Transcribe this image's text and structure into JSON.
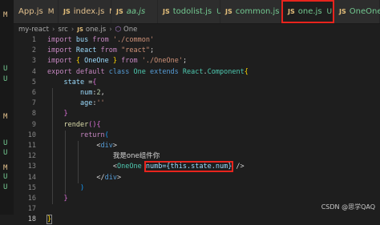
{
  "tabs": [
    {
      "label": "App.js",
      "badge": "M",
      "kind": "m"
    },
    {
      "label": "index.js",
      "badge": "M",
      "kind": "m",
      "icon": "JS"
    },
    {
      "label": "aa.js",
      "badge": "",
      "kind": "u",
      "icon": "JS"
    },
    {
      "label": "todolist.js",
      "badge": "U",
      "kind": "u",
      "icon": "JS"
    },
    {
      "label": "common.js",
      "badge": "U",
      "kind": "u",
      "icon": "JS"
    },
    {
      "label": "one.js",
      "badge": "U",
      "kind": "u",
      "icon": "JS",
      "active": true
    },
    {
      "label": "OneOne",
      "badge": "",
      "kind": "u",
      "icon": "JS"
    }
  ],
  "breadcrumb": {
    "items": [
      "my-react",
      "src",
      "one.js",
      "One"
    ],
    "icon": "JS"
  },
  "activity_letters": [
    {
      "text": "M",
      "kind": "m"
    },
    {
      "text": "U",
      "kind": "u"
    },
    {
      "text": "U",
      "kind": "u"
    },
    {
      "text": "M",
      "kind": "m"
    },
    {
      "text": "U",
      "kind": "u"
    },
    {
      "text": "U",
      "kind": "u"
    },
    {
      "text": "M",
      "kind": "m"
    },
    {
      "text": "U",
      "kind": "u"
    },
    {
      "text": "U",
      "kind": "u"
    }
  ],
  "code_lines": [
    {
      "n": "1",
      "segs": [
        [
          "kw",
          "import "
        ],
        [
          "var",
          "bus"
        ],
        [
          "kw",
          " from "
        ],
        [
          "str",
          "'./common'"
        ]
      ]
    },
    {
      "n": "2",
      "segs": [
        [
          "kw",
          "import "
        ],
        [
          "var",
          "React"
        ],
        [
          "kw",
          " from "
        ],
        [
          "str",
          "\"react\""
        ],
        [
          "",
          "; "
        ]
      ]
    },
    {
      "n": "3",
      "segs": [
        [
          "kw",
          "import "
        ],
        [
          "br1",
          "{ "
        ],
        [
          "var",
          "OneOne"
        ],
        [
          "br1",
          " }"
        ],
        [
          "kw",
          " from "
        ],
        [
          "str",
          "'./OneOne'"
        ],
        [
          "",
          ";"
        ]
      ]
    },
    {
      "n": "4",
      "segs": [
        [
          "kw",
          "export default "
        ],
        [
          "kb",
          "class "
        ],
        [
          "cls",
          "One "
        ],
        [
          "kb",
          "extends "
        ],
        [
          "cls",
          "React"
        ],
        [
          "",
          "."
        ],
        [
          "cls",
          "Component"
        ],
        [
          "br1",
          "{"
        ]
      ]
    },
    {
      "n": "5",
      "segs": [
        [
          "",
          "    "
        ],
        [
          "var",
          "state"
        ],
        [
          "",
          " ="
        ],
        [
          "br2",
          "{"
        ]
      ]
    },
    {
      "n": "6",
      "segs": [
        [
          "",
          "        "
        ],
        [
          "var",
          "num"
        ],
        [
          "",
          ":"
        ],
        [
          "num",
          "2"
        ],
        [
          "",
          ","
        ]
      ]
    },
    {
      "n": "7",
      "segs": [
        [
          "",
          "        "
        ],
        [
          "var",
          "age"
        ],
        [
          "",
          ":"
        ],
        [
          "str",
          "''"
        ]
      ]
    },
    {
      "n": "8",
      "segs": [
        [
          "",
          "    "
        ],
        [
          "br2",
          "}"
        ]
      ]
    },
    {
      "n": "9",
      "segs": [
        [
          "",
          "    "
        ],
        [
          "fn",
          "render"
        ],
        [
          "br2",
          "()"
        ],
        [
          "br2",
          "{"
        ]
      ]
    },
    {
      "n": "10",
      "segs": [
        [
          "",
          "        "
        ],
        [
          "kw",
          "return"
        ],
        [
          "br3",
          "("
        ]
      ]
    },
    {
      "n": "11",
      "segs": [
        [
          "",
          "            "
        ],
        [
          "",
          "<"
        ],
        [
          "tag",
          "div"
        ],
        [
          "",
          ">"
        ]
      ]
    },
    {
      "n": "12",
      "segs": [
        [
          "",
          "                "
        ],
        [
          "jsxt",
          "我是one组件你"
        ]
      ]
    },
    {
      "n": "13",
      "segs": [
        [
          "",
          "                "
        ],
        [
          "",
          "<"
        ],
        [
          "cls",
          "OneOne "
        ],
        [
          "hlbox",
          "numb={this.state.num}"
        ],
        [
          "",
          " />"
        ]
      ]
    },
    {
      "n": "14",
      "segs": [
        [
          "",
          "            "
        ],
        [
          "",
          "</"
        ],
        [
          "tag",
          "div"
        ],
        [
          "",
          ">"
        ]
      ]
    },
    {
      "n": "15",
      "segs": [
        [
          "",
          "        "
        ],
        [
          "br3",
          ")"
        ]
      ]
    },
    {
      "n": "16",
      "segs": [
        [
          "",
          "    "
        ],
        [
          "br2",
          "}"
        ]
      ]
    },
    {
      "n": "17",
      "segs": [
        [
          "",
          ""
        ]
      ]
    },
    {
      "n": "18",
      "segs": [
        [
          "bracket",
          "}"
        ]
      ]
    }
  ],
  "watermark": "CSDN @思学QAQ"
}
